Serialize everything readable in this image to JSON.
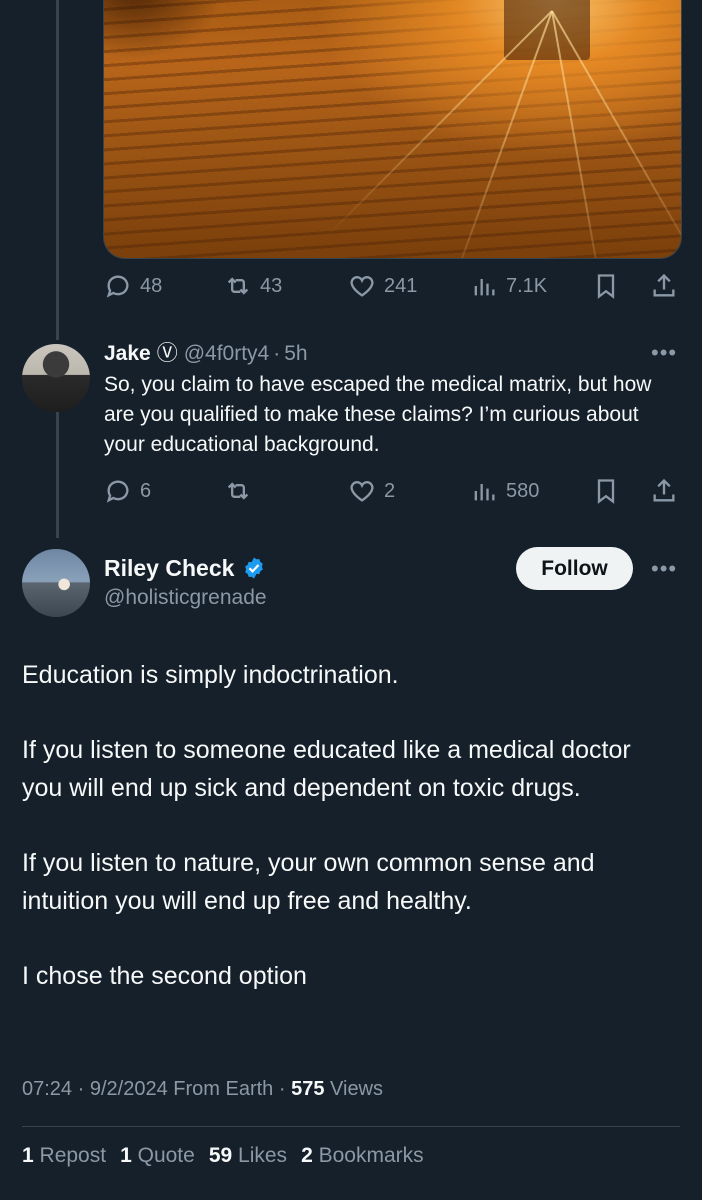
{
  "first_tweet_actions": {
    "replies": "48",
    "reposts": "43",
    "likes": "241",
    "views": "7.1K"
  },
  "reply": {
    "name": "Jake",
    "name_badge": "Ⓥ",
    "handle": "@4f0rty4",
    "time": "5h",
    "text": "So, you claim to have escaped the medical matrix, but how are you qualified to make these claims? I’m curious about your educational background.",
    "actions": {
      "replies": "6",
      "reposts": "",
      "likes": "2",
      "views": "580"
    }
  },
  "main_tweet": {
    "name": "Riley Check",
    "handle": "@holisticgrenade",
    "follow_label": "Follow",
    "paragraphs": [
      "Education is simply indoctrination.",
      "If you listen to someone educated like a medical doctor you will end up sick and dependent on toxic drugs.",
      "If you listen to nature, your own common sense and intuition you will end up free and healthy.",
      "I chose the second option"
    ],
    "time": "07:24",
    "date": "9/2/2024",
    "location": "From Earth",
    "views_count": "575",
    "views_label": "Views",
    "stats": {
      "reposts_count": "1",
      "reposts_label": "Repost",
      "quotes_count": "1",
      "quotes_label": "Quote",
      "likes_count": "59",
      "likes_label": "Likes",
      "bookmarks_count": "2",
      "bookmarks_label": "Bookmarks"
    }
  },
  "colors": {
    "background": "#15202b",
    "text_primary": "#f7f9f9",
    "text_secondary": "#8b98a5",
    "verified_blue": "#1d9bf0",
    "divider": "#38444d"
  }
}
